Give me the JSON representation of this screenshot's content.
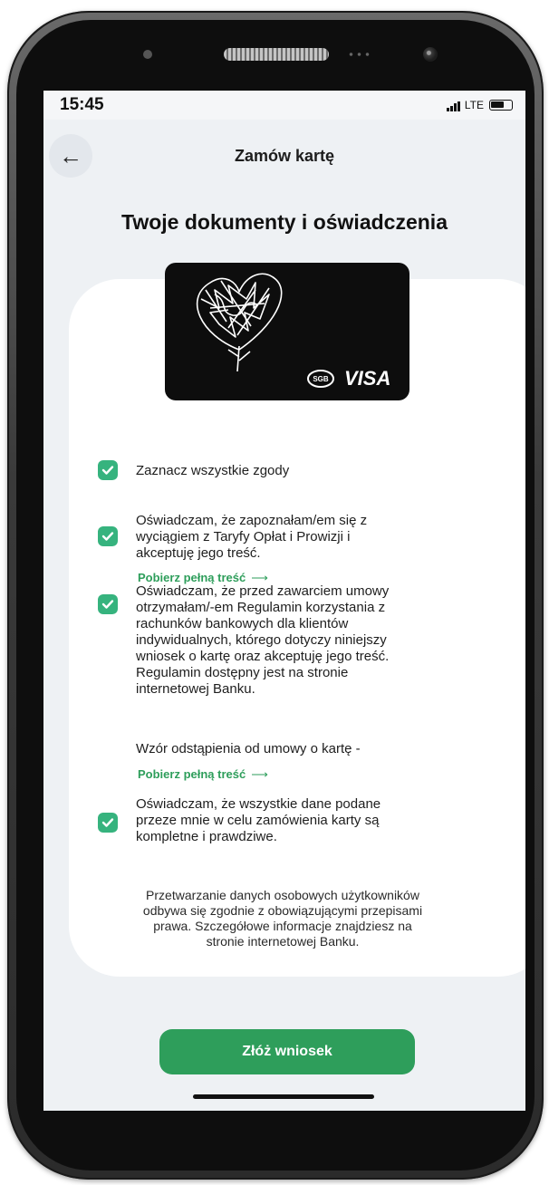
{
  "status_bar": {
    "time": "15:45",
    "network": "LTE"
  },
  "header": {
    "back_icon": "arrow-left-icon",
    "title": "Zamów kartę"
  },
  "page": {
    "title": "Twoje dokumenty i oświadczenia"
  },
  "card": {
    "brand_mark": "SGB",
    "network_logo": "VISA"
  },
  "consents": {
    "all": {
      "label": "Zaznacz wszystkie zgody",
      "checked": true
    },
    "items": [
      {
        "text_lines": [
          "Oświadczam, że zapoznałam/em się z",
          "wyciągiem z Taryfy Opłat i Prowizji i",
          "akceptuję jego treść."
        ],
        "checked": true,
        "link": "Pobierz pełną treść"
      },
      {
        "text_lines": [
          "Oświadczam, że przed zawarciem umowy",
          "otrzymałam/-em Regulamin korzystania z",
          "rachunków bankowych dla klientów",
          "indywidualnych, którego dotyczy niniejszy",
          "wniosek o kartę oraz akceptuję jego treść.",
          "Regulamin dostępny jest na stronie",
          "internetowej Banku."
        ],
        "checked": true
      },
      {
        "text_lines": [
          "Wzór odstąpienia od umowy o kartę -"
        ],
        "link": "Pobierz pełną treść"
      },
      {
        "text_lines": [
          "Oświadczam, że wszystkie dane podane",
          "przeze mnie w celu zamówienia karty są",
          "kompletne i prawdziwe."
        ],
        "checked": true
      }
    ]
  },
  "footer_note_lines": [
    "Przetwarzanie danych osobowych użytkowników",
    "odbywa się zgodnie z obowiązującymi przepisami",
    "prawa. Szczegółowe informacje znajdziesz na",
    "stronie internetowej Banku."
  ],
  "submit_label": "Złóż wniosek",
  "colors": {
    "accent": "#2e9e5b",
    "checkbox": "#36b37e",
    "background": "#eef1f4"
  }
}
